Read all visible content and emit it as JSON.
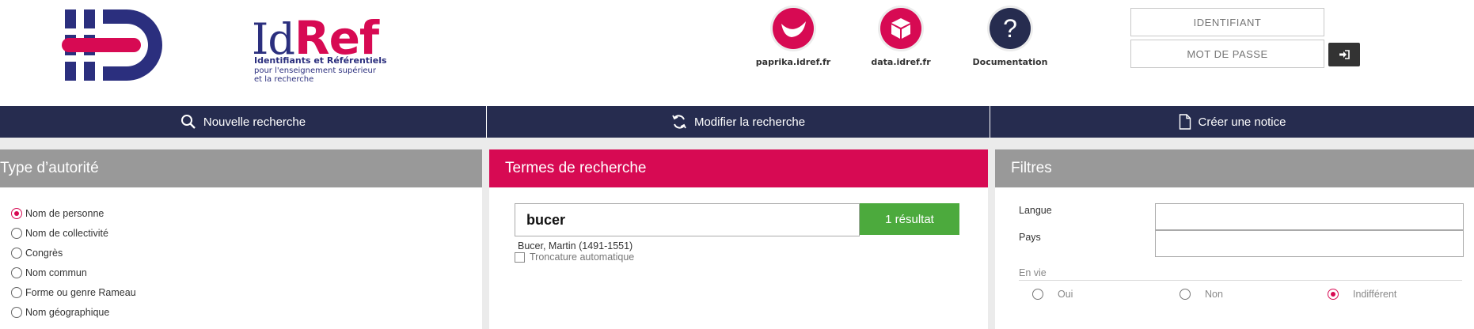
{
  "logo": {
    "id_text": "Id",
    "ref_text": "Ref",
    "subtitle": "Identifiants et Référentiels",
    "tagline": "pour l'enseignement supérieur et la recherche",
    "brand_pink": "#d70a53",
    "brand_navy": "#2b2f7e"
  },
  "quick_links": [
    {
      "label": "paprika.idref.fr",
      "icon": "smile-icon"
    },
    {
      "label": "data.idref.fr",
      "icon": "cube-icon"
    },
    {
      "label": "Documentation",
      "icon": "question-icon"
    }
  ],
  "login": {
    "identifiant_placeholder": "IDENTIFIANT",
    "password_placeholder": "MOT DE PASSE",
    "submit_icon": "sign-in-icon"
  },
  "nav": {
    "new_search": "Nouvelle recherche",
    "modify_search": "Modifier la recherche",
    "create_record": "Créer une notice",
    "background": "#262c4f"
  },
  "authority_panel": {
    "title": "Type d’autorité",
    "options": [
      {
        "label": "Nom de personne",
        "checked": true
      },
      {
        "label": "Nom de collectivité",
        "checked": false
      },
      {
        "label": "Congrès",
        "checked": false
      },
      {
        "label": "Nom commun",
        "checked": false
      },
      {
        "label": "Forme ou genre Rameau",
        "checked": false
      },
      {
        "label": "Nom géographique",
        "checked": false
      }
    ]
  },
  "search_panel": {
    "title": "Termes de recherche",
    "query": "bucer",
    "result_button": "1 résultat",
    "result_color": "#4caa3d",
    "suggestion": "Bucer, Martin (1491-1551)",
    "truncation_label": "Troncature automatique"
  },
  "filters_panel": {
    "title": "Filtres",
    "language_label": "Langue",
    "country_label": "Pays",
    "alive_label": "En vie",
    "alive_options": [
      {
        "label": "Oui",
        "checked": false
      },
      {
        "label": "Non",
        "checked": false
      },
      {
        "label": "Indifférent",
        "checked": true
      }
    ]
  }
}
